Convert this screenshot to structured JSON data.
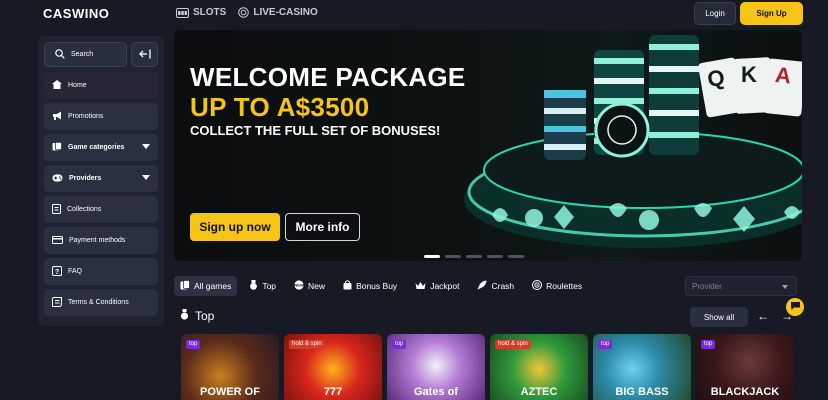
{
  "header": {
    "logo": "CASWINO",
    "nav": [
      {
        "label": "SLOTS",
        "icon": "slots-icon"
      },
      {
        "label": "LIVE-CASINO",
        "icon": "live-casino-icon"
      }
    ],
    "login_label": "Login",
    "signup_label": "Sign Up"
  },
  "sidebar": {
    "search_label": "Search",
    "items": [
      {
        "label": "Home",
        "icon": "home-icon"
      },
      {
        "label": "Promotions",
        "icon": "megaphone-icon"
      },
      {
        "label": "Game categories",
        "icon": "cards-icon"
      },
      {
        "label": "Providers",
        "icon": "gamepad-icon"
      },
      {
        "label": "Collections",
        "icon": "document-icon"
      },
      {
        "label": "Payment methods",
        "icon": "card-icon"
      },
      {
        "label": "FAQ",
        "icon": "question-icon"
      },
      {
        "label": "Terms & Conditions",
        "icon": "terms-icon"
      }
    ]
  },
  "banner": {
    "line1": "WELCOME PACKAGE",
    "line2": "UP TO A$3500",
    "line3": "COLLECT THE FULL SET OF BONUSES!",
    "signup_label": "Sign up now",
    "more_label": "More info",
    "slide_count": 5,
    "active_slide": 1
  },
  "categories": {
    "tabs": [
      {
        "label": "All games",
        "icon": "all-games-icon"
      },
      {
        "label": "Top",
        "icon": "medal-icon"
      },
      {
        "label": "New",
        "icon": "new-icon"
      },
      {
        "label": "Bonus Buy",
        "icon": "bag-icon"
      },
      {
        "label": "Jackpot",
        "icon": "crown-icon"
      },
      {
        "label": "Crash",
        "icon": "rocket-icon"
      },
      {
        "label": "Roulettes",
        "icon": "roulette-icon"
      }
    ],
    "provider_placeholder": "Provider"
  },
  "top_section": {
    "title": "Top",
    "show_all_label": "Show all",
    "prev_arrow": "←",
    "next_arrow": "→"
  },
  "games": [
    {
      "badges": [
        "top"
      ],
      "label": "POWER OF"
    },
    {
      "badges": [
        "hold & spin"
      ],
      "label": "777"
    },
    {
      "badges": [
        "top"
      ],
      "label": "Gates of"
    },
    {
      "badges": [
        "hold & spin"
      ],
      "label": "AZTEC"
    },
    {
      "badges": [
        "top"
      ],
      "label": "BIG BASS"
    },
    {
      "badges": [
        "top"
      ],
      "label": "BLACKJACK"
    }
  ],
  "colors": {
    "accent": "#f6c417",
    "background": "#171a24",
    "panel": "#1f2331",
    "badge_top": "#7a2bd9",
    "badge_hold": "#d83a2a"
  }
}
